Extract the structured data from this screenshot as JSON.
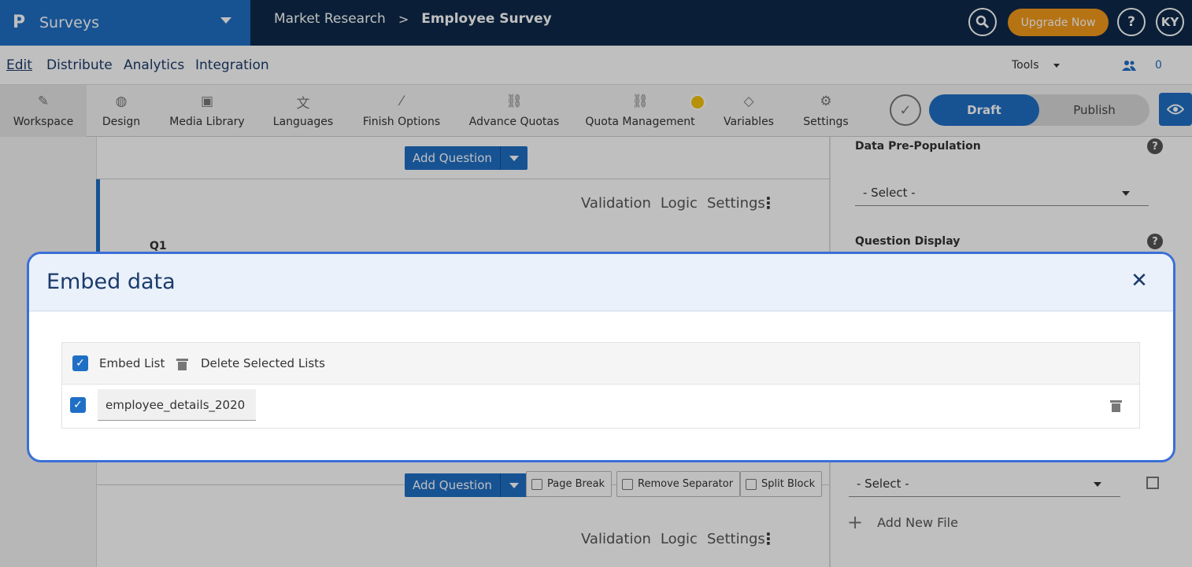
{
  "app": {
    "name": "Surveys",
    "logo": "P"
  },
  "breadcrumb": {
    "parent": "Market Research",
    "separator": ">",
    "current": "Employee Survey"
  },
  "header": {
    "upgrade_label": "Upgrade Now",
    "help_glyph": "?",
    "user_initials": "KY"
  },
  "menu": {
    "items": [
      "Edit",
      "Distribute",
      "Analytics",
      "Integration"
    ],
    "tools_label": "Tools",
    "collaborators_count": "0"
  },
  "toolbar": {
    "items": [
      "Workspace",
      "Design",
      "Media Library",
      "Languages",
      "Finish Options",
      "Advance Quotas",
      "Quota Management",
      "Variables",
      "Settings"
    ],
    "draft_label": "Draft",
    "publish_label": "Publish"
  },
  "workspace": {
    "add_question_label": "Add Question",
    "question_tabs": [
      "Validation",
      "Logic",
      "Settings"
    ],
    "question_number": "Q1",
    "page_break_label": "Page Break",
    "remove_separator_label": "Remove Separator",
    "split_block_label": "Split Block"
  },
  "right_panel": {
    "data_prepopulation_title": "Data Pre-Population",
    "question_display_title": "Question Display",
    "select_placeholder": "- Select -",
    "add_new_file_label": "Add New File"
  },
  "modal": {
    "title": "Embed data",
    "embed_list_label": "Embed List",
    "delete_selected_label": "Delete Selected Lists",
    "lists": [
      {
        "name": "employee_details_2020",
        "checked": true
      }
    ]
  },
  "colors": {
    "brand_blue": "#1f6fc5",
    "nav_dark": "#0e2a4a",
    "upgrade_orange": "#f39a1b",
    "modal_border": "#3a6fd8"
  }
}
